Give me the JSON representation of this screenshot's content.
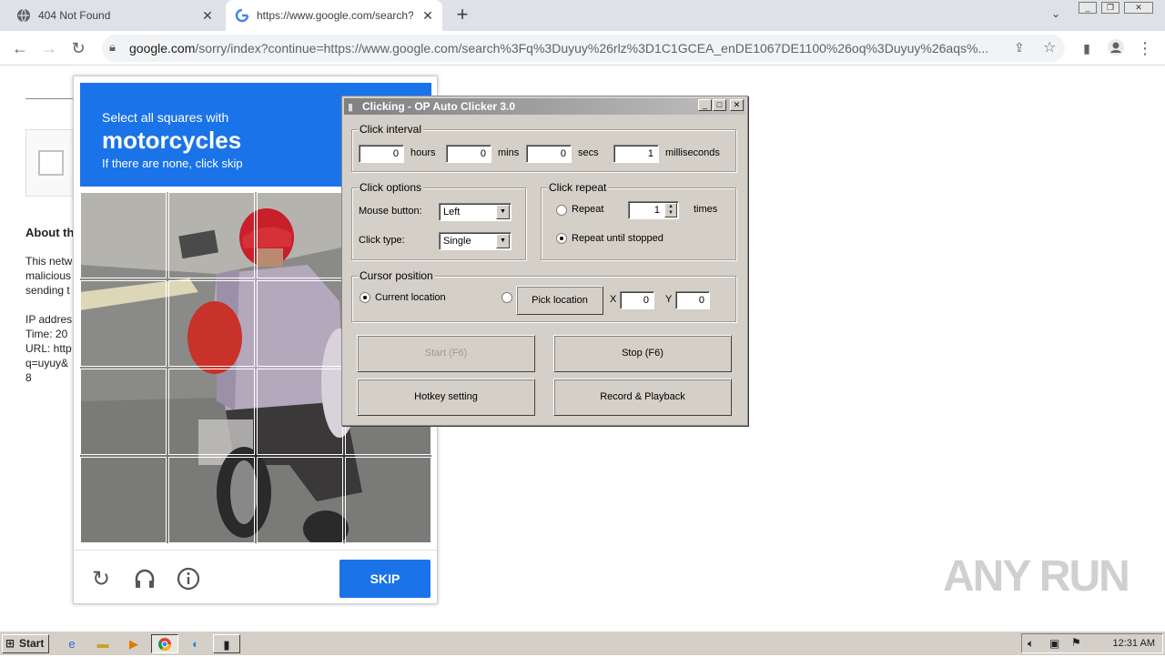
{
  "browser": {
    "tabs": [
      {
        "title": "404 Not Found",
        "icon": "globe-icon"
      },
      {
        "title": "https://www.google.com/search?q=",
        "icon": "google-icon"
      }
    ],
    "url_host": "google.com",
    "url_rest": "/sorry/index?continue=https://www.google.com/search%3Fq%3Duyuy%26rlz%3D1C1GCEA_enDE1067DE1100%26oq%3Duyuy%26aqs%..."
  },
  "page_behind": {
    "about_heading": "About th",
    "lines": [
      "This netw",
      "malicious",
      "sending t",
      "",
      "IP addres",
      "Time: 20",
      "URL: http",
      "q=uyuy&",
      "8"
    ]
  },
  "captcha": {
    "instruction": "Select all squares with",
    "target": "motorcycles",
    "hint": "If there are none, click skip",
    "skip_label": "SKIP"
  },
  "clicker": {
    "title": "Clicking - OP Auto Clicker 3.0",
    "interval": {
      "title": "Click interval",
      "hours": "0",
      "hours_label": "hours",
      "mins": "0",
      "mins_label": "mins",
      "secs": "0",
      "secs_label": "secs",
      "ms": "1",
      "ms_label": "milliseconds"
    },
    "options": {
      "title": "Click options",
      "mouse_label": "Mouse button:",
      "mouse_value": "Left",
      "type_label": "Click type:",
      "type_value": "Single"
    },
    "repeat": {
      "title": "Click repeat",
      "repeat_label": "Repeat",
      "repeat_value": "1",
      "times_label": "times",
      "until_label": "Repeat until stopped"
    },
    "cursor": {
      "title": "Cursor position",
      "current_label": "Current location",
      "pick_label": "Pick location",
      "x_label": "X",
      "x_value": "0",
      "y_label": "Y",
      "y_value": "0"
    },
    "buttons": {
      "start": "Start (F6)",
      "stop": "Stop (F6)",
      "hotkey": "Hotkey setting",
      "record": "Record & Playback"
    }
  },
  "watermark": "ANY RUN",
  "taskbar": {
    "start_label": "Start",
    "clock": "12:31 AM"
  }
}
